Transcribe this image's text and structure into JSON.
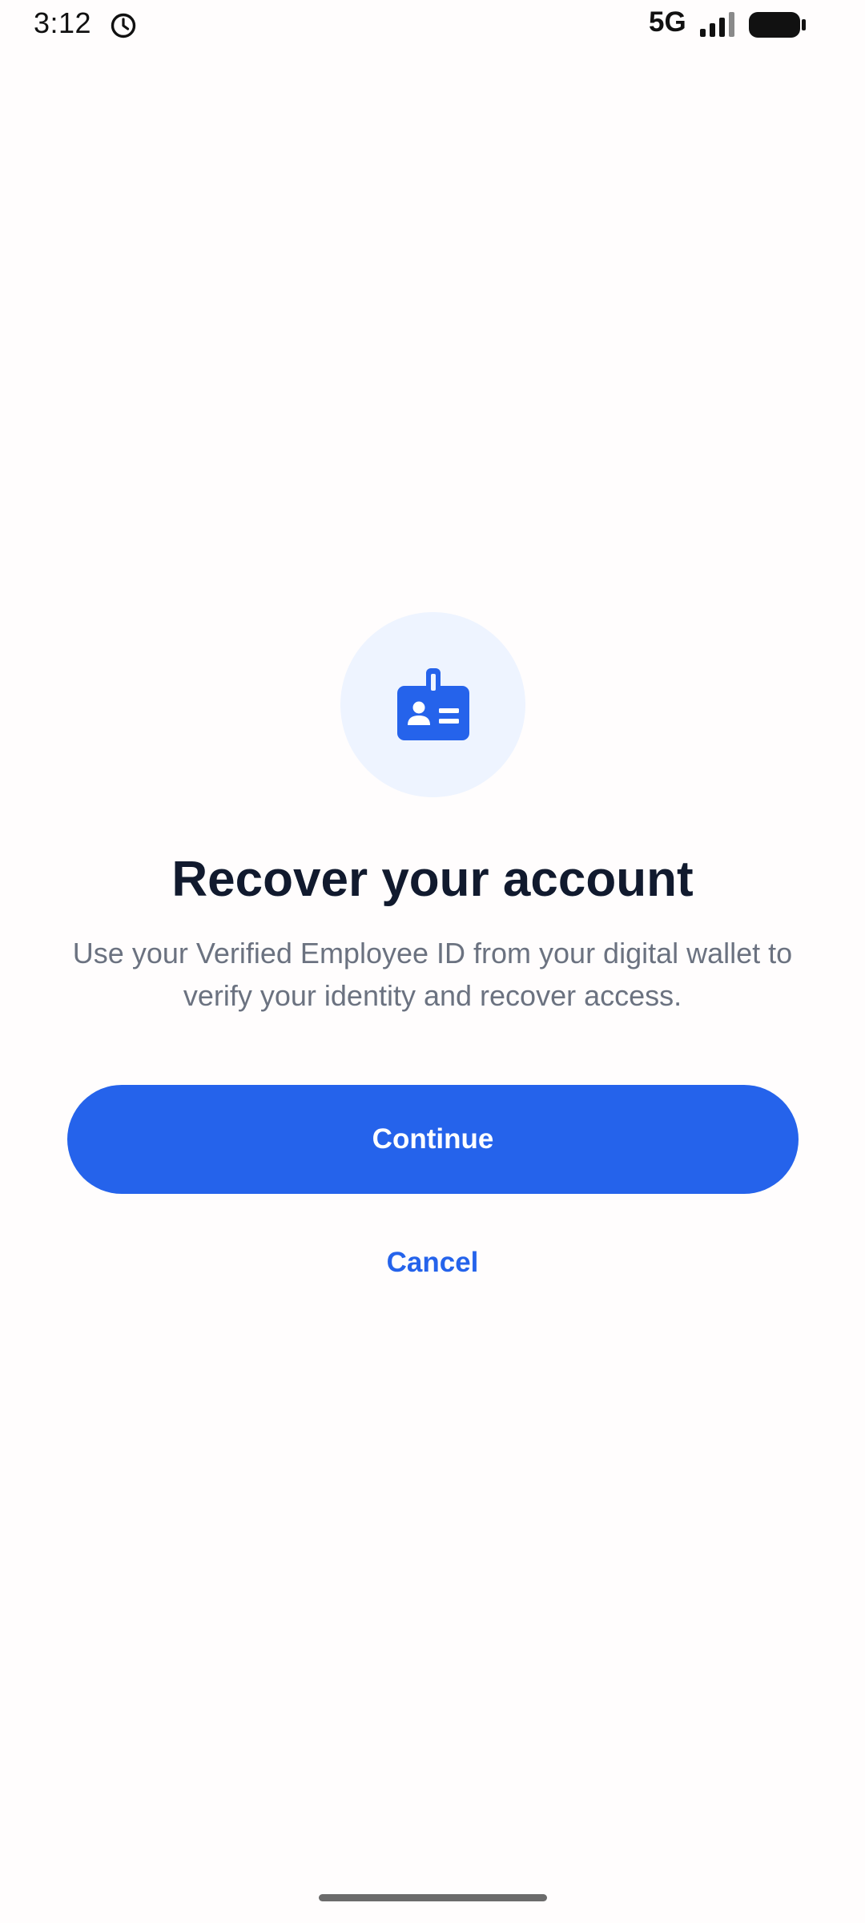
{
  "status_bar": {
    "time": "3:12",
    "network": "5G",
    "alarm_icon": "alarm-clock-icon",
    "signal_icon": "signal-bars-icon",
    "battery_icon": "battery-icon"
  },
  "hero": {
    "icon": "id-badge-icon"
  },
  "main": {
    "title": "Recover your account",
    "description": "Use your Verified Employee ID from your digital wallet to verify your identity and recover access."
  },
  "actions": {
    "continue_label": "Continue",
    "cancel_label": "Cancel"
  },
  "colors": {
    "primary": "#2563eb",
    "icon_background": "#eef4ff",
    "title": "#111a2e",
    "description": "#6b7280",
    "page_background": "#fffdfd"
  }
}
